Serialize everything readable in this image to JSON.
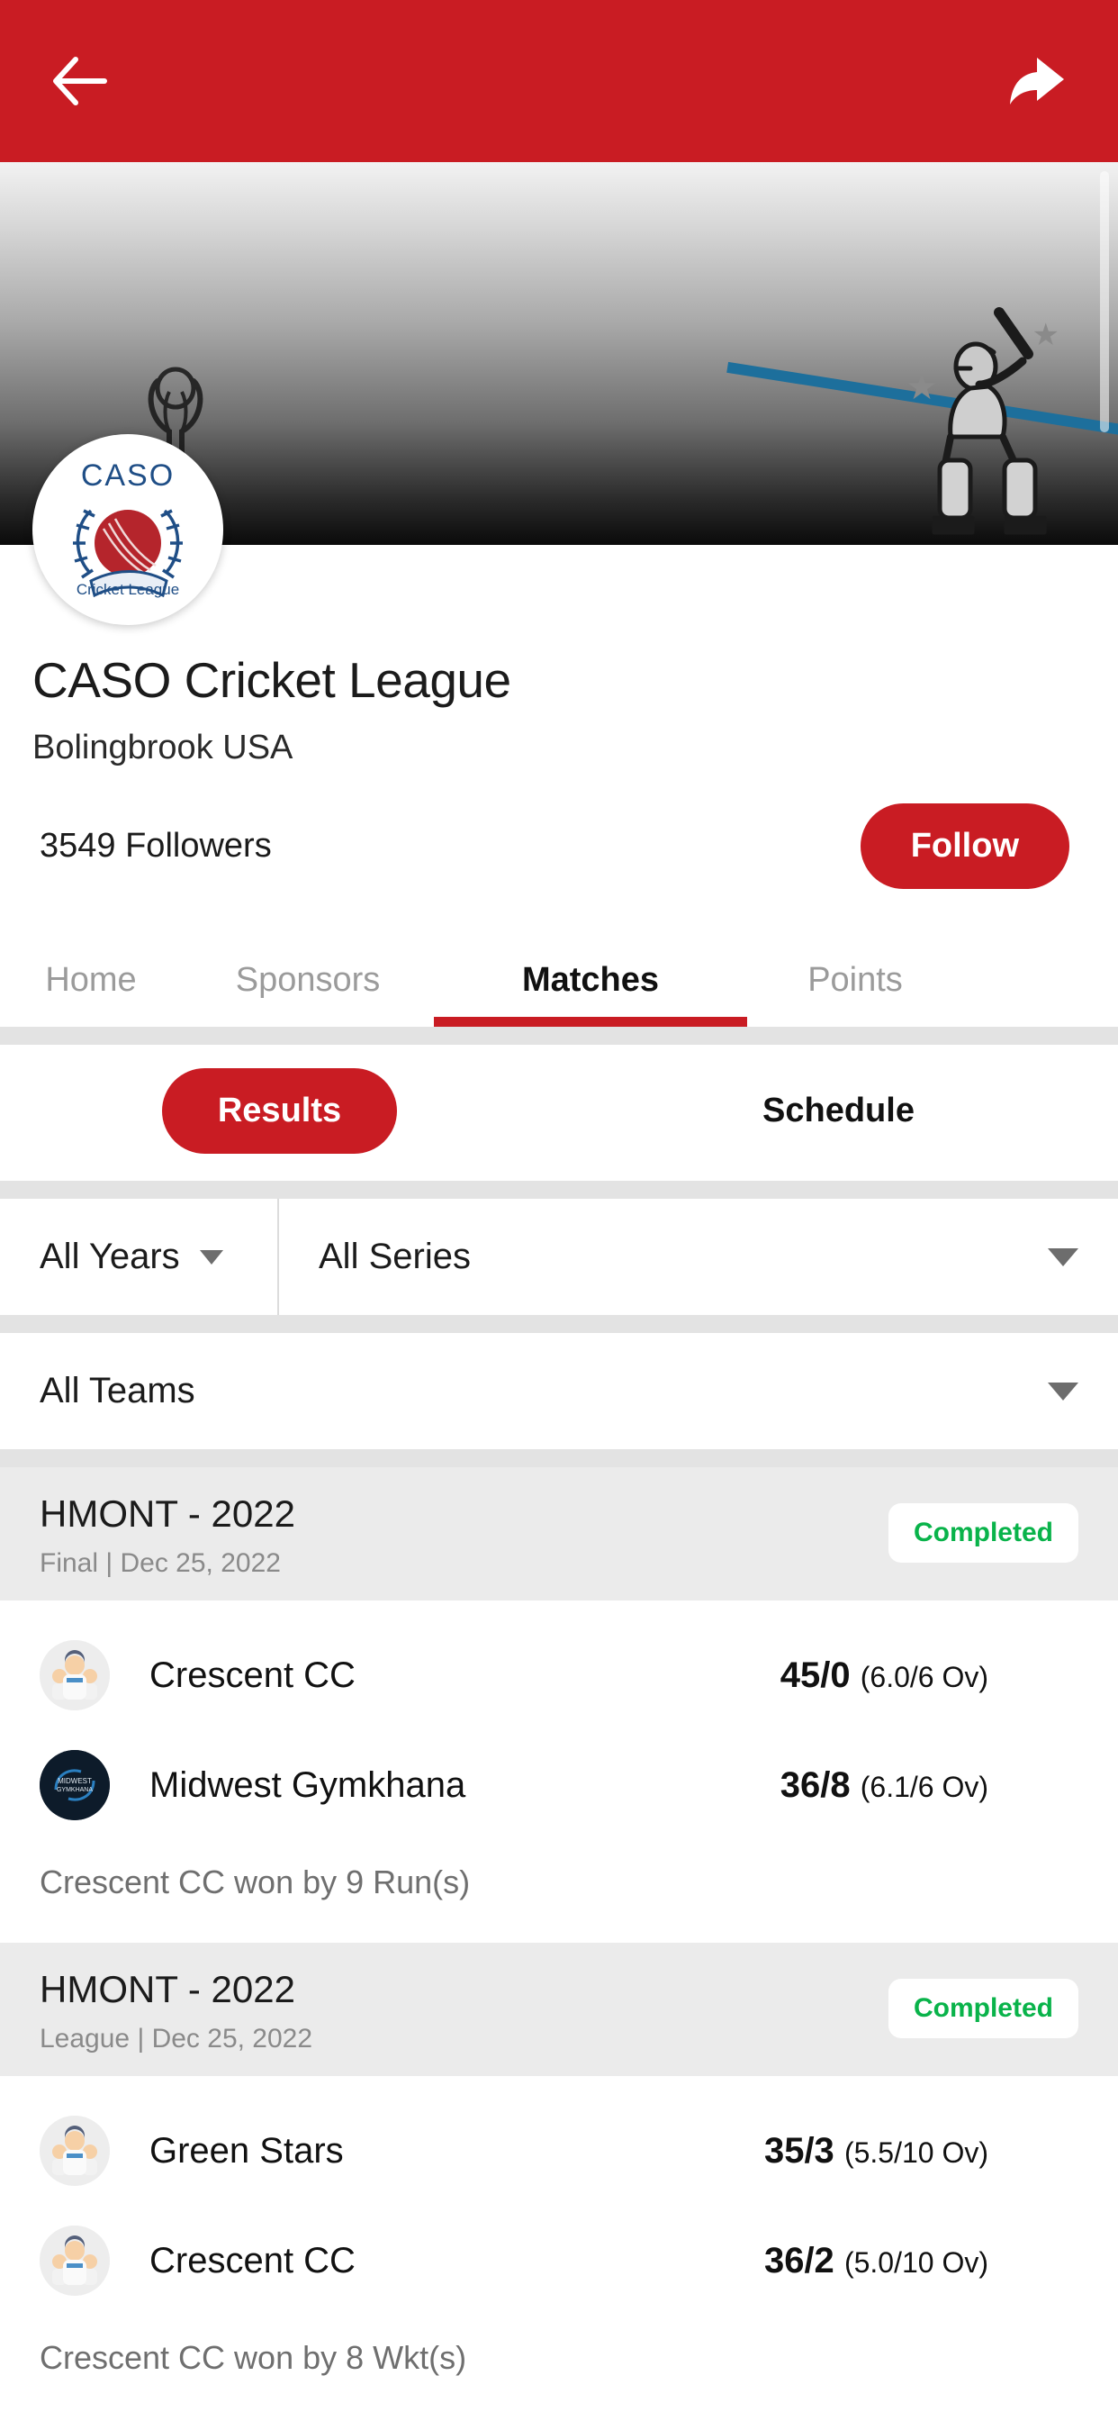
{
  "appbar": {
    "back_icon": "back-arrow-icon",
    "share_icon": "share-icon",
    "bg_color": "#C91C23"
  },
  "banner": {
    "batsman_icon": "cricket-batsman-illustration",
    "trophy_icon": "cricket-trophy-icon",
    "star_icon": "star-icon",
    "accent_blue": "#2488bd"
  },
  "profile": {
    "logo_text_top": "CASO",
    "logo_text_ribbon": "Cricket League",
    "title": "CASO Cricket League",
    "location": "Bolingbrook USA",
    "followers": "3549 Followers",
    "follow_label": "Follow",
    "brand_red": "#C91C23"
  },
  "tabs": [
    {
      "label": "Home",
      "active": false
    },
    {
      "label": "Sponsors",
      "active": false
    },
    {
      "label": "Matches",
      "active": true
    },
    {
      "label": "Points",
      "active": false
    }
  ],
  "segment": {
    "results_label": "Results",
    "schedule_label": "Schedule",
    "active": "Results"
  },
  "filters": {
    "years": "All Years",
    "series": "All Series",
    "teams": "All Teams"
  },
  "matches": [
    {
      "title": "HMONT - 2022",
      "subtitle": "Final | Dec 25, 2022",
      "status": "Completed",
      "status_color": "#09b34a",
      "teams": [
        {
          "name": "Crescent CC",
          "score": "45/0",
          "overs": "(6.0/6 Ov)",
          "logo": "generic-team-avatar"
        },
        {
          "name": "Midwest Gymkhana",
          "score": "36/8",
          "overs": "(6.1/6 Ov)",
          "logo": "midwest-gymkhana-logo"
        }
      ],
      "result": "Crescent CC won by 9 Run(s)"
    },
    {
      "title": "HMONT - 2022",
      "subtitle": "League | Dec 25, 2022",
      "status": "Completed",
      "status_color": "#09b34a",
      "teams": [
        {
          "name": "Green Stars",
          "score": "35/3",
          "overs": "(5.5/10 Ov)",
          "logo": "generic-team-avatar"
        },
        {
          "name": "Crescent CC",
          "score": "36/2",
          "overs": "(5.0/10 Ov)",
          "logo": "generic-team-avatar"
        }
      ],
      "result": "Crescent CC won by 8 Wkt(s)"
    }
  ]
}
